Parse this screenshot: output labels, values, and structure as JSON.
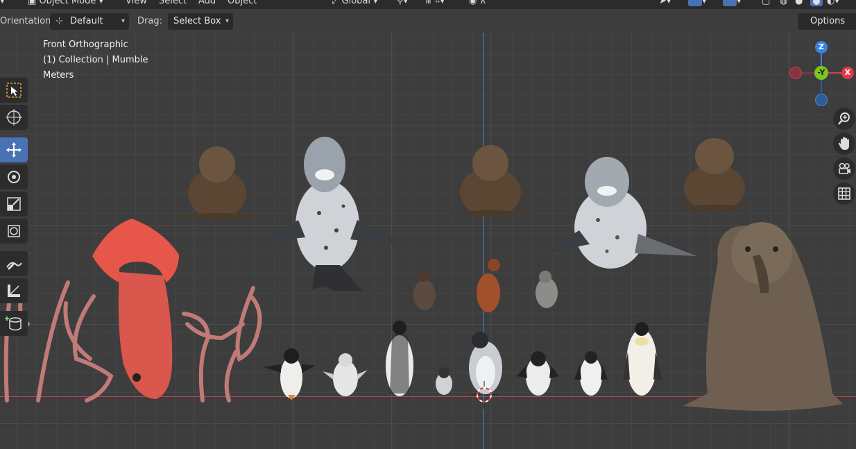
{
  "header": {
    "mode_label": "Object Mode",
    "menus": [
      "View",
      "Select",
      "Add",
      "Object"
    ],
    "transform_orientation": "Global"
  },
  "toolbar_settings": {
    "orientation_label": "Orientation:",
    "orientation_value": "Default",
    "drag_label": "Drag:",
    "drag_value": "Select Box",
    "options_label": "Options"
  },
  "viewport_info": {
    "view_name": "Front Orthographic",
    "collection": "(1) Collection | Mumble",
    "units": "Meters"
  },
  "gizmo": {
    "z": "Z",
    "y": "-Y",
    "x": "X"
  },
  "tools": [
    "select-box-tool",
    "cursor-tool",
    "move-tool",
    "rotate-tool",
    "scale-tool",
    "transform-tool",
    "annotate-tool",
    "measure-tool",
    "add-cube-tool"
  ],
  "nav_buttons": [
    "zoom",
    "pan",
    "camera-view",
    "toggle-ortho"
  ],
  "colors": {
    "viewport_bg": "#3d3d3d",
    "x_axis": "#b5474e",
    "z_axis": "#4a7fc9",
    "active_tool": "#4772b3",
    "gizmo_x": "#e0384c",
    "gizmo_y": "#7cc521",
    "gizmo_z": "#3b82e0"
  },
  "scene_objects": [
    "squid",
    "squid-tentacles",
    "leopard-seal",
    "elephant-seal",
    "weddell-seal",
    "skua-bird",
    "emperor-penguin",
    "adelie-penguin",
    "rockhopper-penguin",
    "penguin-chick"
  ]
}
